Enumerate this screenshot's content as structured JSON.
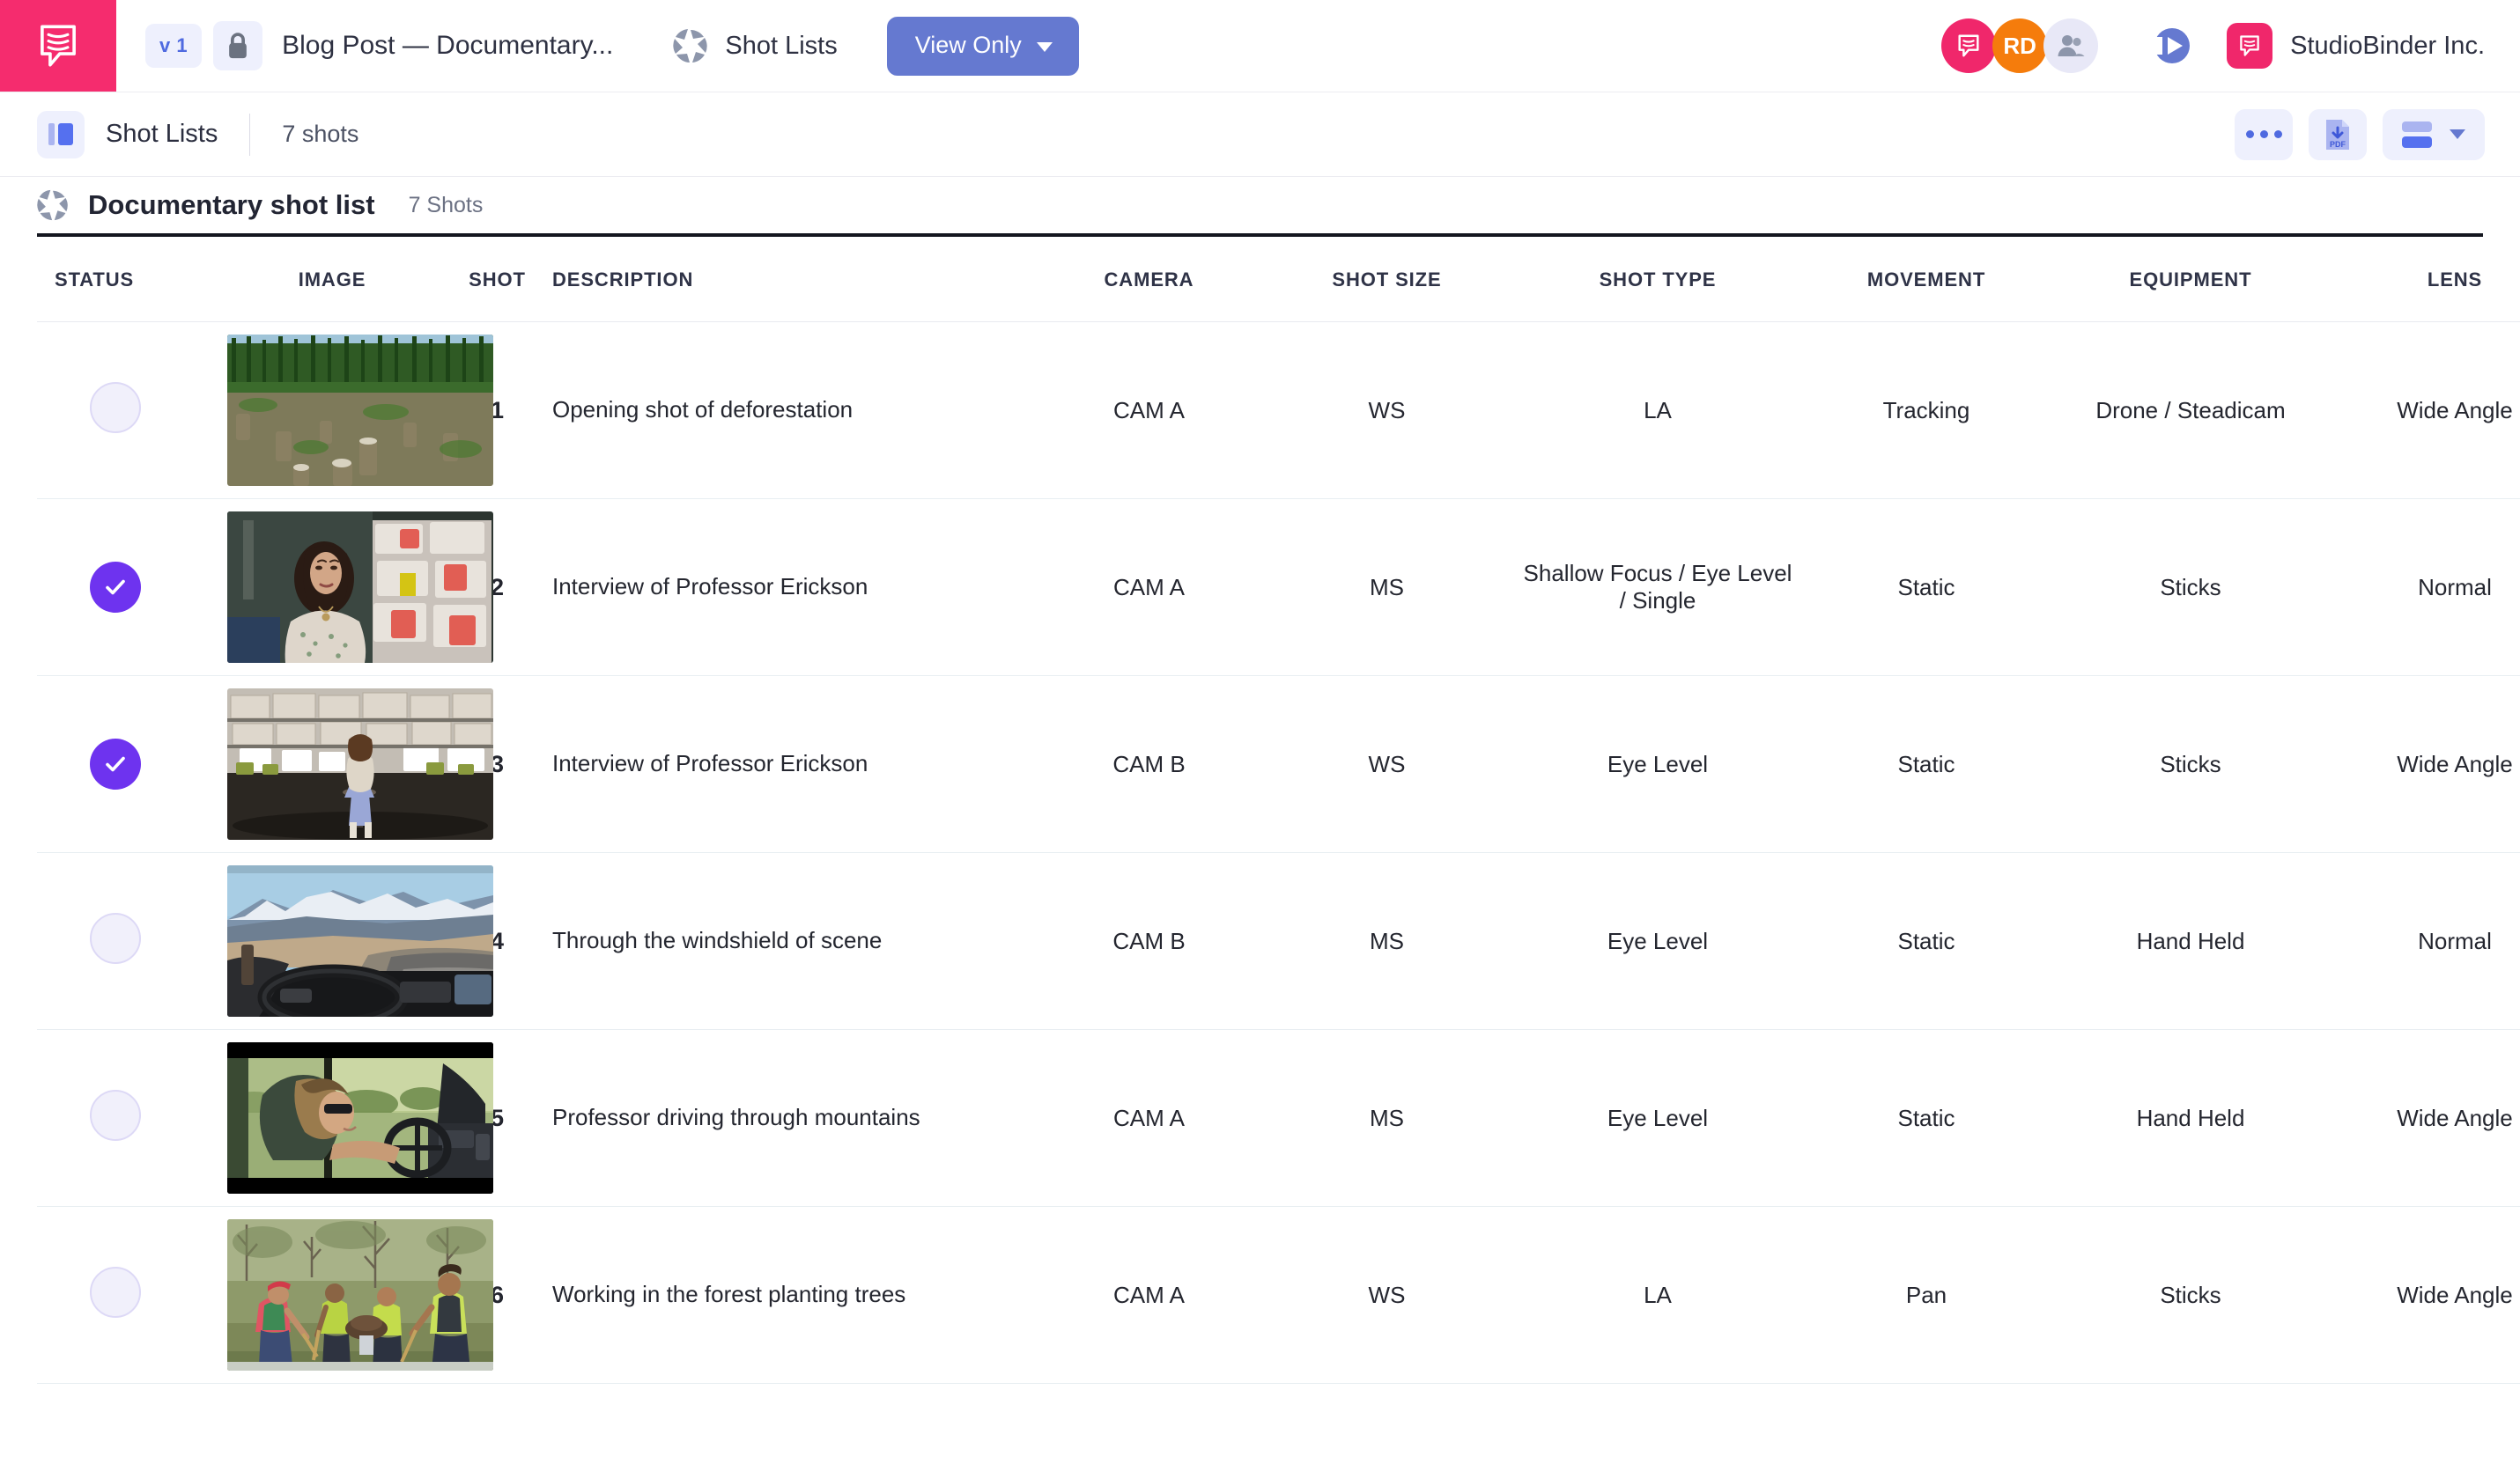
{
  "topbar": {
    "logo_icon": "studiobinder-logo-icon",
    "version": "v 1",
    "lock_icon": "lock-icon",
    "project_title": "Blog Post — Documentary...",
    "module_icon": "aperture-icon",
    "module_label": "Shot Lists",
    "view_mode_button": "View Only",
    "avatars": [
      {
        "name": "comment-avatar",
        "initials": "",
        "color": "#f0276b"
      },
      {
        "name": "user-avatar-rd",
        "initials": "RD",
        "color": "#f57c0c"
      },
      {
        "name": "team-avatar",
        "initials": "",
        "color": "#e8e8f7"
      }
    ],
    "play_icon": "play-circle-icon",
    "brand_icon": "studiobinder-mark-icon",
    "brand_name": "StudioBinder Inc."
  },
  "subbar": {
    "module_icon": "shot-list-icon",
    "title": "Shot Lists",
    "shot_count": "7 shots",
    "more_icon": "ellipsis-icon",
    "export_icon": "pdf-download-icon",
    "layout_icon": "layout-toggle-icon"
  },
  "list_header": {
    "icon": "aperture-icon",
    "title": "Documentary shot list",
    "count": "7 Shots"
  },
  "table": {
    "columns": [
      "STATUS",
      "IMAGE",
      "SHOT",
      "DESCRIPTION",
      "CAMERA",
      "SHOT SIZE",
      "SHOT TYPE",
      "MOVEMENT",
      "EQUIPMENT",
      "LENS"
    ],
    "rows": [
      {
        "status": "incomplete",
        "image": "deforestation-stumps-thumbnail",
        "shot": "1",
        "description": "Opening shot of deforestation",
        "camera": "CAM A",
        "shot_size": "WS",
        "shot_type": "LA",
        "movement": "Tracking",
        "equipment": "Drone / Steadicam",
        "lens": "Wide Angle"
      },
      {
        "status": "complete",
        "image": "interview-woman-warehouse-closeup-thumbnail",
        "shot": "2",
        "description": "Interview of Professor Erickson",
        "camera": "CAM A",
        "shot_size": "MS",
        "shot_type": "Shallow Focus / Eye Level / Single",
        "movement": "Static",
        "equipment": "Sticks",
        "lens": "Normal"
      },
      {
        "status": "complete",
        "image": "interview-woman-warehouse-wide-thumbnail",
        "shot": "3",
        "description": "Interview of Professor Erickson",
        "camera": "CAM B",
        "shot_size": "WS",
        "shot_type": "Eye Level",
        "movement": "Static",
        "equipment": "Sticks",
        "lens": "Wide Angle"
      },
      {
        "status": "incomplete",
        "image": "windshield-mountain-road-thumbnail",
        "shot": "4",
        "description": "Through the windshield of scene",
        "camera": "CAM B",
        "shot_size": "MS",
        "shot_type": "Eye Level",
        "movement": "Static",
        "equipment": "Hand Held",
        "lens": "Normal"
      },
      {
        "status": "incomplete",
        "image": "woman-driving-car-thumbnail",
        "shot": "5",
        "description": "Professor driving through mountains",
        "camera": "CAM A",
        "shot_size": "MS",
        "shot_type": "Eye Level",
        "movement": "Static",
        "equipment": "Hand Held",
        "lens": "Wide Angle"
      },
      {
        "status": "incomplete",
        "image": "volunteers-planting-trees-thumbnail",
        "shot": "6",
        "description": "Working in the forest planting trees",
        "camera": "CAM A",
        "shot_size": "WS",
        "shot_type": "LA",
        "movement": "Pan",
        "equipment": "Sticks",
        "lens": "Wide Angle"
      }
    ]
  },
  "colors": {
    "brand_pink": "#f52c6e",
    "accent_blue": "#6579d0",
    "status_purple": "#6e33ef",
    "chip_bg": "#eef0fd"
  }
}
